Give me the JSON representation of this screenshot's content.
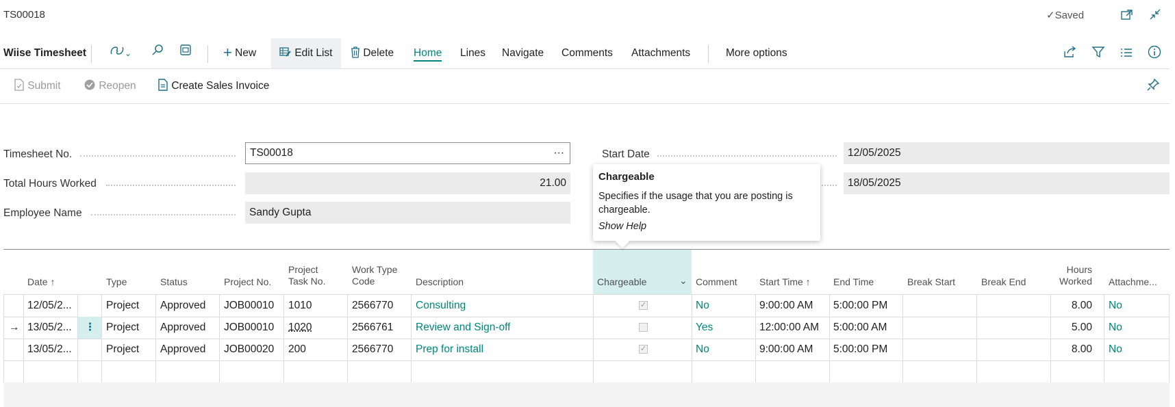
{
  "title": "TS00018",
  "status": "Saved",
  "actionbar": {
    "page_name": "Wiise Timesheet",
    "new": "New",
    "edit_list": "Edit List",
    "delete": "Delete",
    "home": "Home",
    "lines": "Lines",
    "navigate": "Navigate",
    "comments": "Comments",
    "attachments": "Attachments",
    "more": "More options"
  },
  "subbar": {
    "submit": "Submit",
    "reopen": "Reopen",
    "create_invoice": "Create Sales Invoice"
  },
  "form": {
    "timesheet_no_label": "Timesheet No.",
    "timesheet_no": "TS00018",
    "total_hours_label": "Total Hours Worked",
    "total_hours": "21.00",
    "employee_label": "Employee Name",
    "employee": "Sandy Gupta",
    "start_date_label": "Start Date",
    "start_date": "12/05/2025",
    "end_date": "18/05/2025"
  },
  "tooltip": {
    "title": "Chargeable",
    "body": "Specifies if the usage that you are posting is chargeable.",
    "help": "Show Help"
  },
  "columns": {
    "date": "Date ↑",
    "type": "Type",
    "status": "Status",
    "project_no": "Project No.",
    "task_no_1": "Project",
    "task_no_2": "Task No.",
    "work_type_1": "Work Type",
    "work_type_2": "Code",
    "description": "Description",
    "chargeable": "Chargeable",
    "comment": "Comment",
    "start_time": "Start Time ↑",
    "end_time": "End Time",
    "break_start": "Break Start",
    "break_end": "Break End",
    "hours_1": "Hours",
    "hours_2": "Worked",
    "attachments": "Attachme..."
  },
  "rows": [
    {
      "date": "12/05/2...",
      "type": "Project",
      "status": "Approved",
      "project": "JOB00010",
      "task": "1010",
      "work": "2566770",
      "desc": "Consulting",
      "chargeable": true,
      "comment": "No",
      "start": "9:00:00 AM",
      "end": "5:00:00 PM",
      "hours": "8.00",
      "attach": "No"
    },
    {
      "date": "13/05/2...",
      "type": "Project",
      "status": "Approved",
      "project": "JOB00010",
      "task": "1020",
      "work": "2566761",
      "desc": "Review and Sign-off",
      "chargeable": false,
      "comment": "Yes",
      "start": "12:00:00 AM",
      "end": "5:00:00 AM",
      "hours": "5.00",
      "attach": "No"
    },
    {
      "date": "13/05/2...",
      "type": "Project",
      "status": "Approved",
      "project": "JOB00020",
      "task": "200",
      "work": "2566770",
      "desc": "Prep for install",
      "chargeable": true,
      "comment": "No",
      "start": "9:00:00 AM",
      "end": "5:00:00 PM",
      "hours": "8.00",
      "attach": "No"
    }
  ],
  "icons": {
    "saved": "check-icon",
    "new": "plus-icon",
    "edit_list": "edit-list-icon",
    "delete": "trash-icon",
    "copilot": "copilot-icon",
    "search": "search-icon",
    "layout": "layout-icon"
  },
  "colors": {
    "accent": "#00857c",
    "icon": "#1f6f86",
    "highlight": "#d5eeee"
  }
}
